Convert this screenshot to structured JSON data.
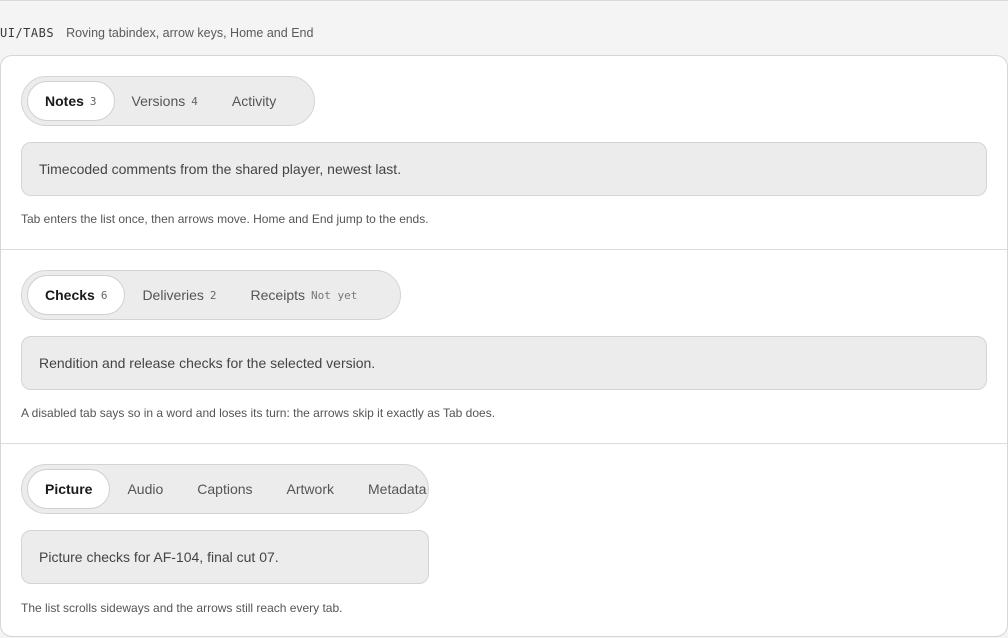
{
  "header": {
    "code": "UI/TABS",
    "subtitle": "Roving tabindex, arrow keys, Home and End"
  },
  "sections": [
    {
      "tabs": [
        {
          "label": "Notes",
          "count": "3",
          "active": true
        },
        {
          "label": "Versions",
          "count": "4"
        },
        {
          "label": "Activity"
        }
      ],
      "panel": "Timecoded comments from the shared player, newest last.",
      "hint": "Tab enters the list once, then arrows move. Home and End jump to the ends."
    },
    {
      "tabs": [
        {
          "label": "Checks",
          "count": "6",
          "active": true
        },
        {
          "label": "Deliveries",
          "count": "2"
        },
        {
          "label": "Receipts",
          "badge": "Not yet",
          "disabled": true
        }
      ],
      "panel": "Rendition and release checks for the selected version.",
      "hint": "A disabled tab says so in a word and loses its turn: the arrows skip it exactly as Tab does."
    },
    {
      "tabs": [
        {
          "label": "Picture",
          "active": true
        },
        {
          "label": "Audio"
        },
        {
          "label": "Captions"
        },
        {
          "label": "Artwork"
        },
        {
          "label": "Metadata"
        }
      ],
      "panel": "Picture checks for AF-104, final cut 07.",
      "hint": "The list scrolls sideways and the arrows still reach every tab."
    }
  ]
}
